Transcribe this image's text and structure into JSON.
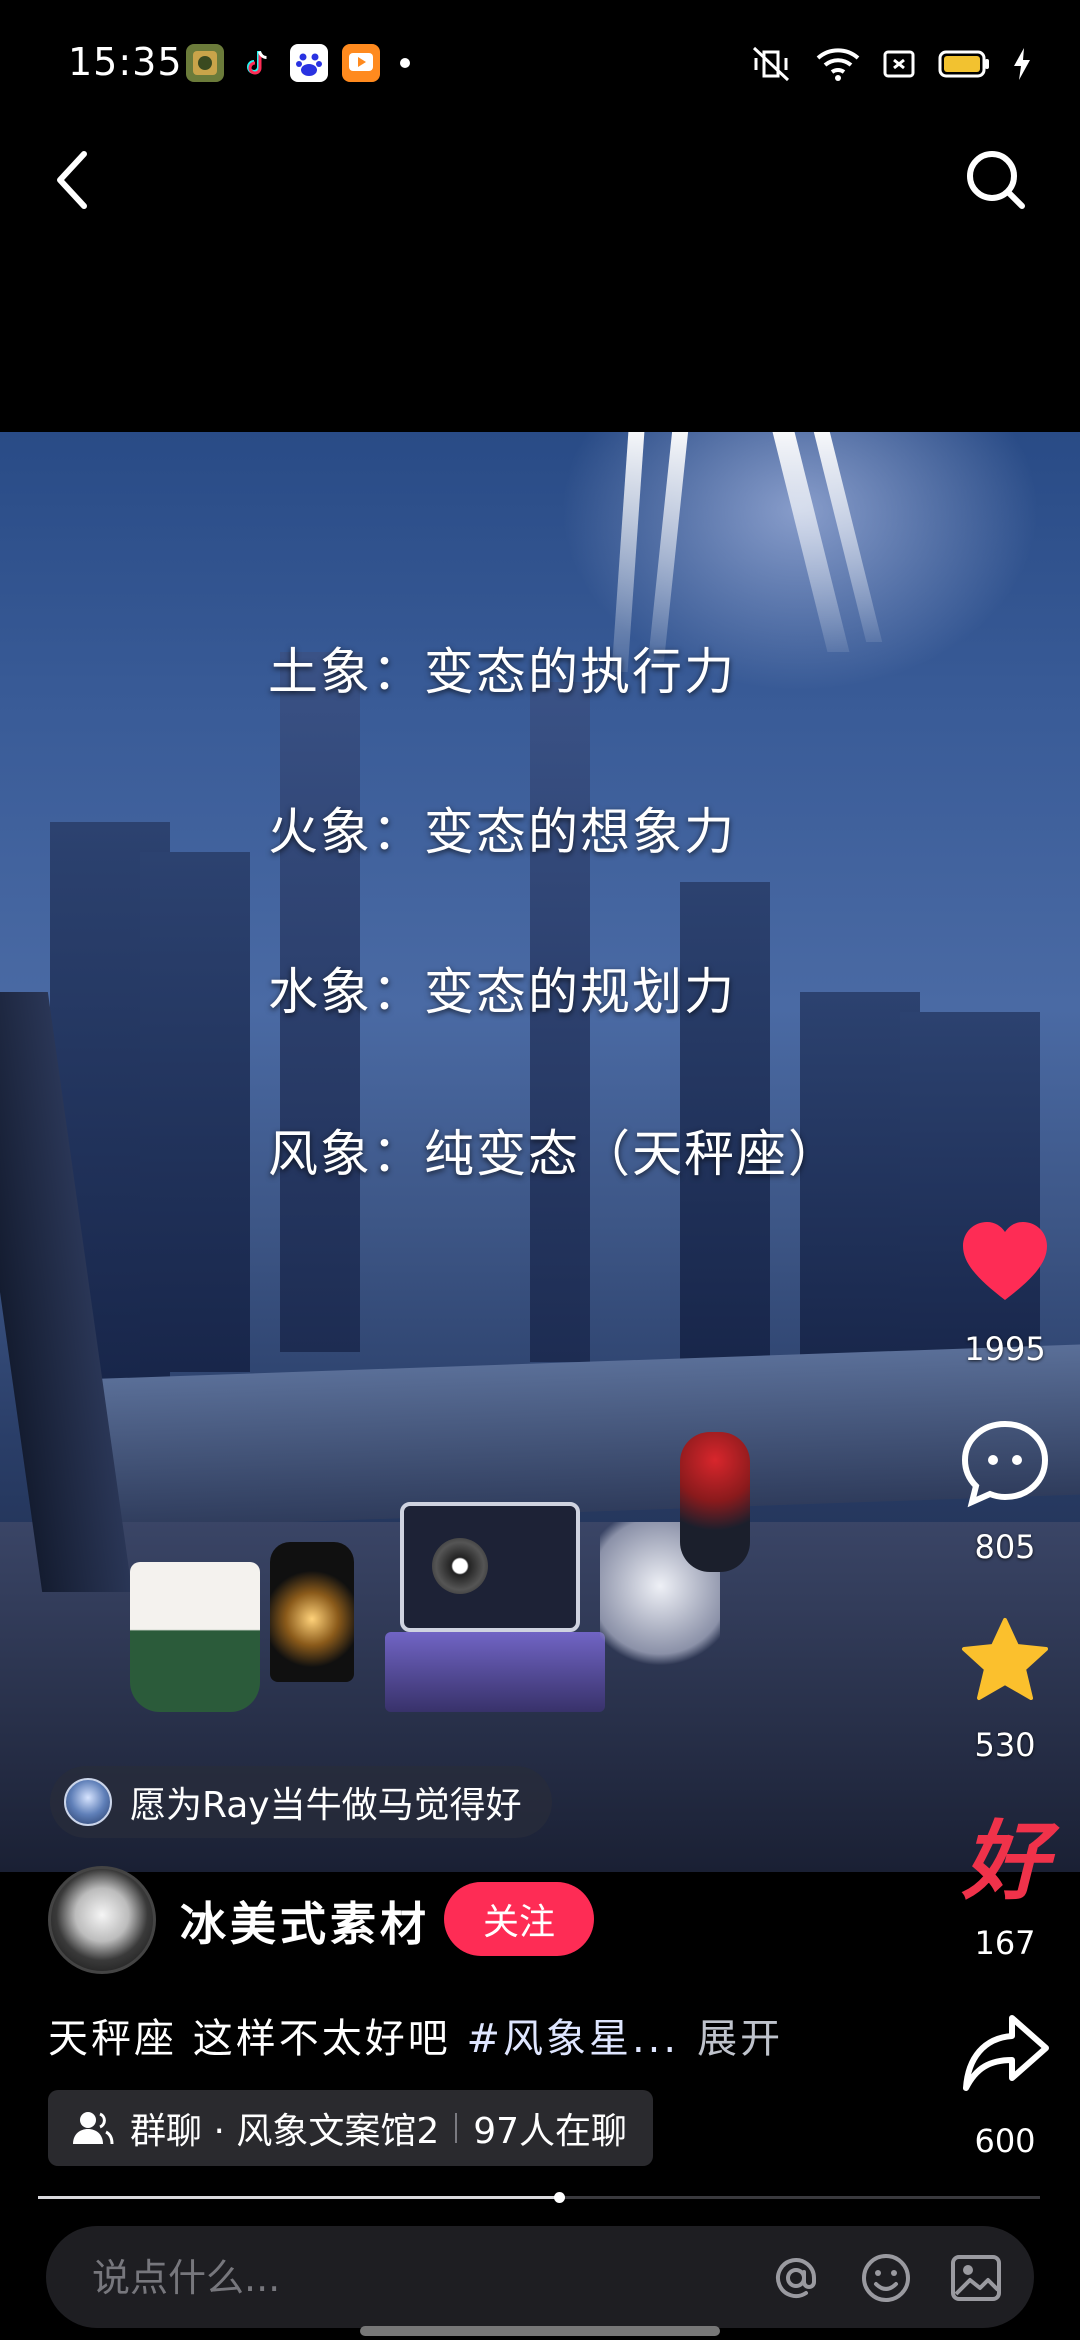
{
  "status_bar": {
    "time": "15:35",
    "app_icons": [
      "game-app-icon",
      "tiktok-icon",
      "baidu-icon",
      "video-app-icon"
    ],
    "right_icons": [
      "mute-vibrate-icon",
      "wifi-icon",
      "sim-card-icon",
      "battery-icon",
      "charging-icon"
    ]
  },
  "nav": {
    "back_icon": "chevron-left-icon",
    "search_icon": "search-icon"
  },
  "video": {
    "caption_lines": [
      "土象：变态的执行力",
      "火象：变态的想象力",
      "水象：变态的规划力",
      "风象：纯变态（天秤座）"
    ],
    "tag_chip": "愿为Ray当牛做马觉得好"
  },
  "actions": {
    "like": {
      "count": "1995",
      "icon": "heart-icon",
      "color": "#fe2c55"
    },
    "comment": {
      "count": "805",
      "icon": "comment-bubble-icon"
    },
    "favorite": {
      "count": "530",
      "icon": "star-icon",
      "color": "#fbc02d"
    },
    "good": {
      "label": "好",
      "count": "167",
      "color": "#f0324a"
    },
    "share": {
      "count": "600",
      "icon": "share-arrow-icon"
    }
  },
  "author": {
    "name": "冰美式素材",
    "follow_label": "关注",
    "accent": "#fe2c55"
  },
  "description": {
    "text": "天秤座 这样不太好吧 ",
    "hashtag": "#风象星...",
    "expand_label": "展开"
  },
  "group": {
    "label": "群聊 · 风象文案馆2",
    "members": "97人在聊"
  },
  "progress": {
    "fraction": 0.52
  },
  "comment_bar": {
    "placeholder": "说点什么...",
    "icons": [
      "at-icon",
      "emoji-icon",
      "image-icon"
    ]
  }
}
